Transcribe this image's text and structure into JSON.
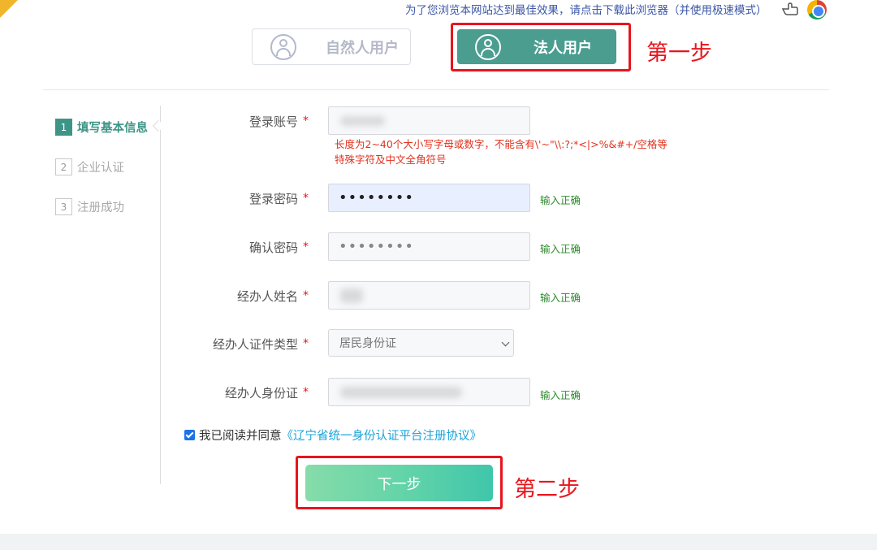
{
  "top_bar": {
    "browser_tip": "为了您浏览本网站达到最佳效果，请点击下载此浏览器（并使用极速模式）",
    "icons": [
      "hand-pointer-icon",
      "chrome-browser-icon"
    ]
  },
  "user_tabs": [
    {
      "label": "自然人用户",
      "icon": "user-circle-icon",
      "selected": false
    },
    {
      "label": "法人用户",
      "icon": "user-circle-icon",
      "selected": true
    }
  ],
  "annotations": {
    "step1": "第一步",
    "step2": "第二步"
  },
  "steps": [
    {
      "num": "1",
      "label": "填写基本信息",
      "active": true
    },
    {
      "num": "2",
      "label": "企业认证",
      "active": false
    },
    {
      "num": "3",
      "label": "注册成功",
      "active": false
    }
  ],
  "form": {
    "required_mark": "*",
    "account": {
      "label": "登录账号",
      "hint": "长度为2~40个大小写字母或数字，不能含有\\'~\"\\\\:?;*<|>%&#+/空格等特殊字符及中文全角符号"
    },
    "password": {
      "label": "登录密码",
      "value": "••••••••",
      "status": "输入正确"
    },
    "confirm_password": {
      "label": "确认密码",
      "value": "••••••••",
      "status": "输入正确"
    },
    "agent_name": {
      "label": "经办人姓名",
      "status": "输入正确"
    },
    "id_type": {
      "label": "经办人证件类型",
      "selected": "居民身份证"
    },
    "id_number": {
      "label": "经办人身份证",
      "status": "输入正确"
    }
  },
  "agreement": {
    "checked": true,
    "text": "我已阅读并同意",
    "link": "《辽宁省统一身份认证平台注册协议》"
  },
  "next_button": "下一步",
  "colors": {
    "accent": "#4a9d8f",
    "annotation_red": "#e8151d",
    "ok_green": "#2e8a2e",
    "link_blue": "#1aa3d9"
  }
}
